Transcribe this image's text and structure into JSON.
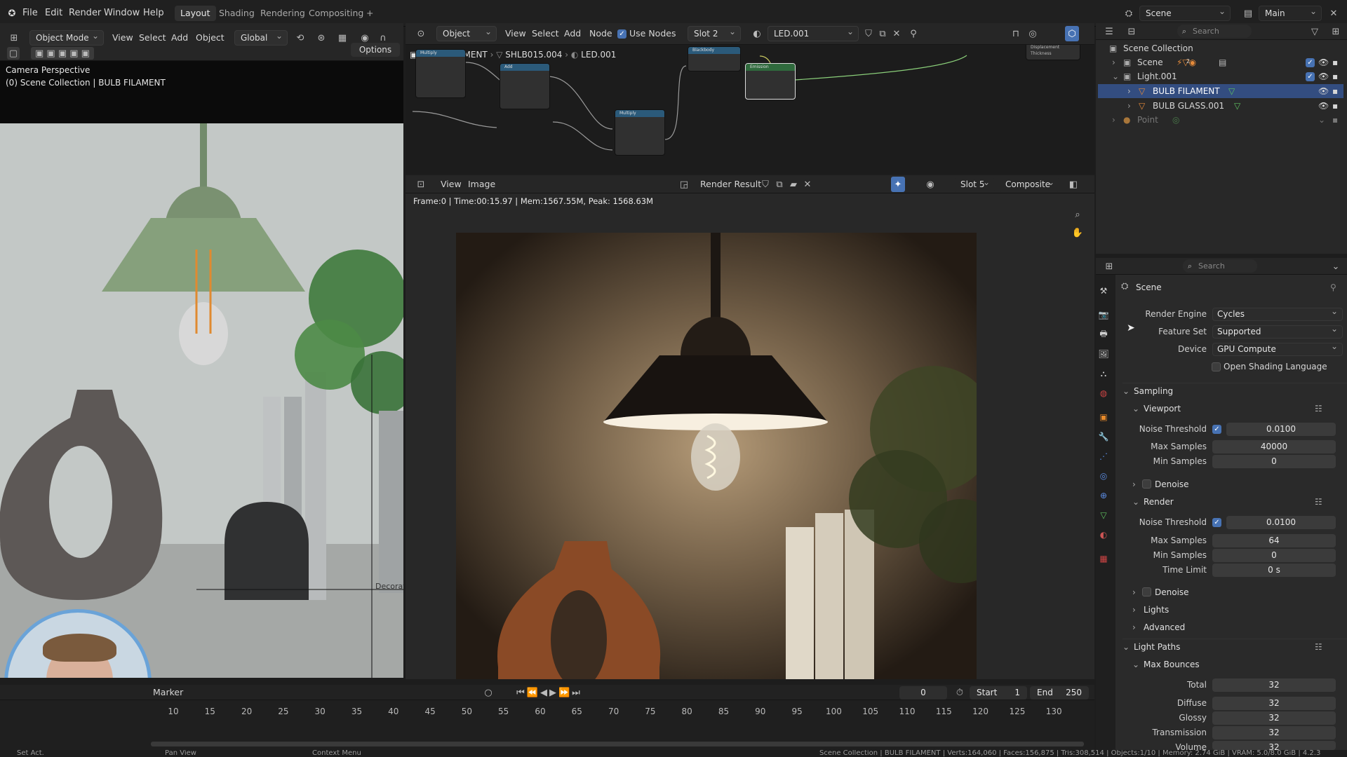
{
  "menu": {
    "items": [
      "File",
      "Edit",
      "Render",
      "Window",
      "Help"
    ],
    "workspaces": [
      "Layout",
      "Shading",
      "Rendering",
      "Compositing"
    ],
    "add_tab": "+",
    "scene_name": "Scene",
    "view_layer": "Main"
  },
  "viewport": {
    "mode": "Object Mode",
    "menus": [
      "View",
      "Select",
      "Add",
      "Object"
    ],
    "orientation": "Global",
    "options": "Options",
    "title": "Camera Perspective",
    "subtitle": "(0) Scene Collection | BULB FILAMENT",
    "obj_label": "Decorat"
  },
  "node_editor": {
    "type": "Object",
    "menus": [
      "View",
      "Select",
      "Add",
      "Node"
    ],
    "use_nodes": "Use Nodes",
    "slot": "Slot 2",
    "material": "LED.001",
    "breadcrumb": [
      "BULB FILAMENT",
      "SHLB015.004",
      "LED.001"
    ],
    "node_multiply1": "Multiply",
    "node_add": "Add",
    "node_multiply2": "Multiply",
    "node_blackbody": "Blackbody",
    "node_emission": "Emission",
    "out_disp": "Displacement",
    "out_thick": "Thickness"
  },
  "image_editor": {
    "menus": [
      "View",
      "Image"
    ],
    "image": "Render Result",
    "slot": "Slot 5",
    "pass": "Composite",
    "stats": "Frame:0 | Time:00:15.97 | Mem:1567.55M, Peak: 1568.63M"
  },
  "timeline": {
    "marker": "Marker",
    "current": "0",
    "start_label": "Start",
    "start": "1",
    "end_label": "End",
    "end": "250",
    "ticks": [
      "10",
      "15",
      "20",
      "25",
      "30",
      "35",
      "40",
      "45",
      "50",
      "55",
      "60",
      "65",
      "70",
      "75",
      "80",
      "85",
      "90",
      "95",
      "100",
      "105",
      "110",
      "115",
      "120",
      "125",
      "130"
    ]
  },
  "status": {
    "left": [
      "Set Act.",
      "Pan View",
      "Context Menu"
    ],
    "right": "Scene Collection | BULB FILAMENT | Verts:164,060 | Faces:156,875 | Tris:308,514 | Objects:1/10 | Memory: 2.74 GiB | VRAM: 5.0/8.0 GiB | 4.2.3"
  },
  "outliner": {
    "search_placeholder": "Search",
    "rows": [
      {
        "label": "Scene Collection",
        "level": 0
      },
      {
        "label": "Scene",
        "level": 1
      },
      {
        "label": "Light.001",
        "level": 1
      },
      {
        "label": "BULB FILAMENT",
        "level": 2,
        "selected": true
      },
      {
        "label": "BULB GLASS.001",
        "level": 2
      },
      {
        "label": "Point",
        "level": 1
      }
    ],
    "badge_count": "2"
  },
  "properties": {
    "search_placeholder": "Search",
    "context": "Scene",
    "render_engine_label": "Render Engine",
    "render_engine": "Cycles",
    "feature_set_label": "Feature Set",
    "feature_set": "Supported",
    "device_label": "Device",
    "device": "GPU Compute",
    "osl": "Open Shading Language",
    "sampling": "Sampling",
    "viewport": "Viewport",
    "noise_label": "Noise Threshold",
    "vp_noise": "0.0100",
    "max_label": "Max Samples",
    "vp_max": "40000",
    "min_label": "Min Samples",
    "vp_min": "0",
    "denoise": "Denoise",
    "render": "Render",
    "r_noise": "0.0100",
    "r_max": "64",
    "r_min": "0",
    "time_label": "Time Limit",
    "r_time": "0 s",
    "lights": "Lights",
    "advanced": "Advanced",
    "light_paths": "Light Paths",
    "max_bounces": "Max Bounces",
    "total_label": "Total",
    "total": "32",
    "diffuse_label": "Diffuse",
    "diffuse": "32",
    "glossy_label": "Glossy",
    "glossy": "32",
    "trans_label": "Transmission",
    "trans": "32",
    "volume_label": "Volume",
    "volume": "32"
  },
  "colors": {
    "accent": "#4772b3",
    "selected_row": "#334d80",
    "header": "#262626"
  }
}
